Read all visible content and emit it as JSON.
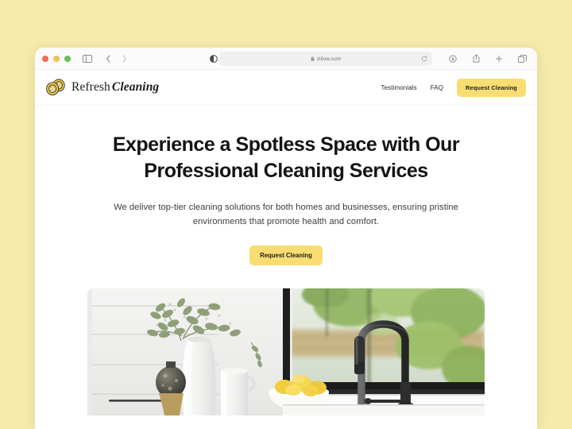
{
  "page": {
    "background_color": "#f6ebab"
  },
  "browser": {
    "url": "zillow.com",
    "traffic_lights": [
      "close",
      "minimize",
      "maximize"
    ],
    "toolbar_icons": {
      "sidebar": "sidebar-icon",
      "back": "chevron-left-icon",
      "forward": "chevron-right-icon",
      "reader": "reader-view-icon",
      "lock": "lock-icon",
      "reload": "reload-icon",
      "downloads": "downloads-icon",
      "share": "share-icon",
      "new_tab": "plus-icon",
      "tab_overview": "tab-overview-icon"
    }
  },
  "site": {
    "brand": {
      "word_one": "Refresh",
      "word_two": "Cleaning",
      "logo_name": "sponge-logo-icon",
      "logo_color": "#e8c54a"
    },
    "nav": {
      "links": [
        {
          "label": "Testimonials"
        },
        {
          "label": "FAQ"
        }
      ],
      "cta_label": "Request Cleaning"
    },
    "hero": {
      "title_line_1": "Experience a Spotless Space with Our",
      "title_line_2": "Professional Cleaning Services",
      "subtitle_line_1": "We deliver top-tier cleaning solutions for both homes and businesses, ensuring",
      "subtitle_line_2": "pristine environments that promote health and comfort.",
      "cta_label": "Request Cleaning",
      "image_alt": "Modern white kitchen with black gooseneck faucet, eucalyptus plant, ceramic vases and a bowl of lemons by a window"
    },
    "accent_color": "#f9dd72"
  }
}
